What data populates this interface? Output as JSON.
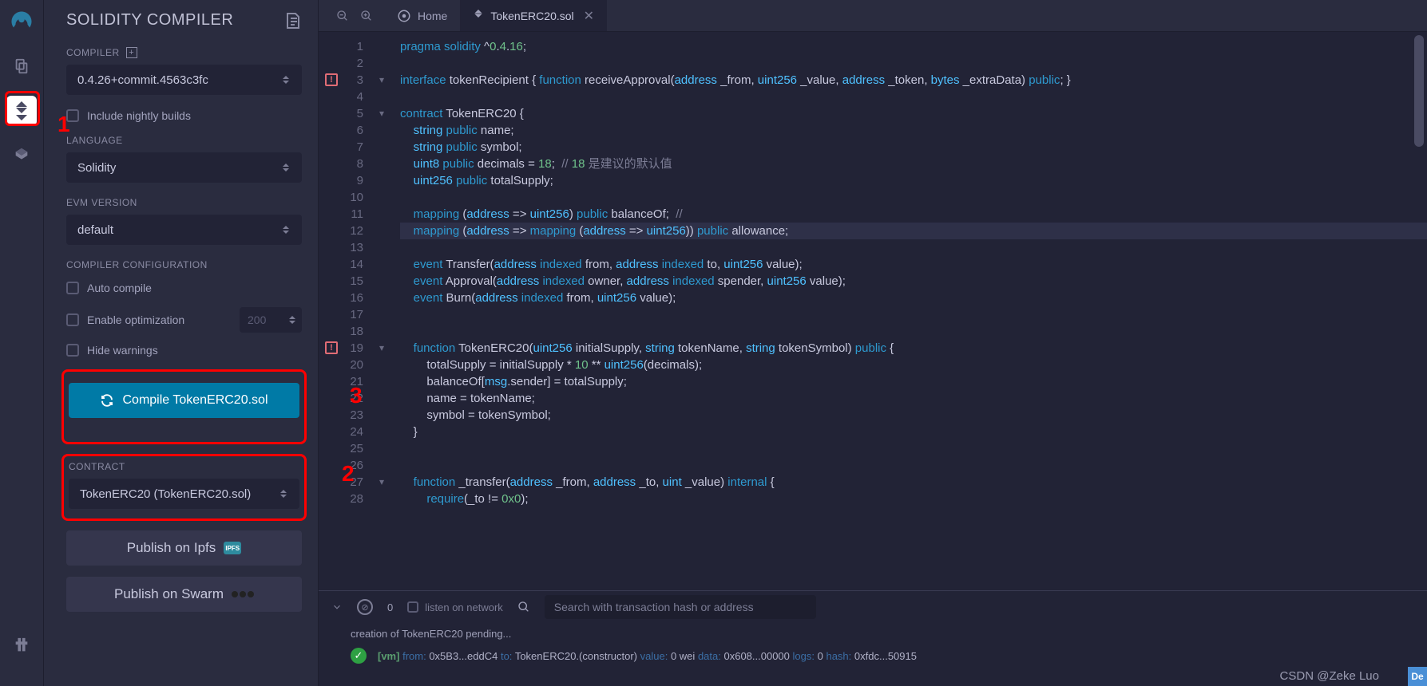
{
  "iconbar": {
    "logo": "remix-logo",
    "items": [
      "file-explorer",
      "solidity-compiler",
      "deploy-run",
      "debugger"
    ],
    "active_index": 1,
    "bottom": "plugin-manager"
  },
  "panel": {
    "title": "SOLIDITY COMPILER",
    "compiler_label": "COMPILER",
    "compiler_value": "0.4.26+commit.4563c3fc",
    "include_nightly": "Include nightly builds",
    "language_label": "LANGUAGE",
    "language_value": "Solidity",
    "evm_label": "EVM VERSION",
    "evm_value": "default",
    "config_label": "COMPILER CONFIGURATION",
    "auto_compile": "Auto compile",
    "enable_opt": "Enable optimization",
    "opt_runs": "200",
    "hide_warnings": "Hide warnings",
    "compile_btn": "Compile TokenERC20.sol",
    "contract_label": "CONTRACT",
    "contract_value": "TokenERC20 (TokenERC20.sol)",
    "publish_ipfs": "Publish on Ipfs",
    "publish_swarm": "Publish on Swarm"
  },
  "tabs": {
    "home": "Home",
    "file": "TokenERC20.sol"
  },
  "editor": {
    "filename": "TokenERC20.sol",
    "highlighted_line": 12,
    "error_lines": [
      3,
      19
    ],
    "lines": [
      "pragma solidity ^0.4.16;",
      "",
      "interface tokenRecipient { function receiveApproval(address _from, uint256 _value, address _token, bytes _extraData) public; }",
      "",
      "contract TokenERC20 {",
      "    string public name;",
      "    string public symbol;",
      "    uint8 public decimals = 18;  // 18 是建议的默认值",
      "    uint256 public totalSupply;",
      "",
      "    mapping (address => uint256) public balanceOf;  //",
      "    mapping (address => mapping (address => uint256)) public allowance;",
      "",
      "    event Transfer(address indexed from, address indexed to, uint256 value);",
      "    event Approval(address indexed owner, address indexed spender, uint256 value);",
      "    event Burn(address indexed from, uint256 value);",
      "",
      "",
      "    function TokenERC20(uint256 initialSupply, string tokenName, string tokenSymbol) public {",
      "        totalSupply = initialSupply * 10 ** uint256(decimals);",
      "        balanceOf[msg.sender] = totalSupply;",
      "        name = tokenName;",
      "        symbol = tokenSymbol;",
      "    }",
      "",
      "",
      "    function _transfer(address _from, address _to, uint _value) internal {",
      "        require(_to != 0x0);"
    ]
  },
  "terminal": {
    "pending_count": "0",
    "listen_label": "listen on network",
    "search_placeholder": "Search with transaction hash or address",
    "line1": "creation of TokenERC20 pending...",
    "log": {
      "vm": "[vm]",
      "from_k": "from:",
      "from_v": "0x5B3...eddC4",
      "to_k": "to:",
      "to_v": "TokenERC20.(constructor)",
      "value_k": "value:",
      "value_v": "0 wei",
      "data_k": "data:",
      "data_v": "0x608...00000",
      "logs_k": "logs:",
      "logs_v": "0",
      "hash_k": "hash:",
      "hash_v": "0xfdc...50915"
    }
  },
  "annotations": {
    "a1": "1",
    "a2": "2",
    "a3": "3"
  },
  "watermark": "CSDN @Zeke Luo",
  "corner": "De"
}
